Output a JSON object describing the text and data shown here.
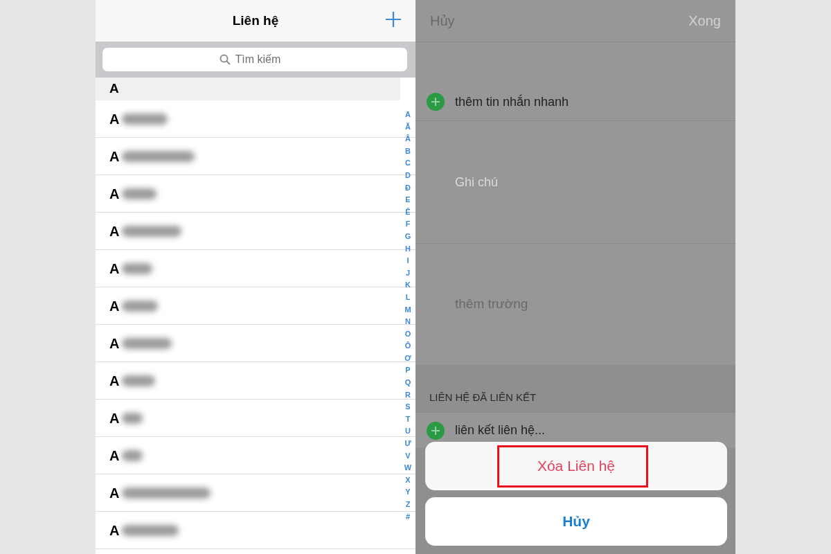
{
  "contacts": {
    "title": "Liên hệ",
    "search": {
      "placeholder": "Tìm kiếm"
    },
    "section_header": "A",
    "rows": [
      {
        "initial": "A"
      },
      {
        "initial": "A"
      },
      {
        "initial": "A"
      },
      {
        "initial": "A"
      },
      {
        "initial": "A"
      },
      {
        "initial": "A"
      },
      {
        "initial": "A"
      },
      {
        "initial": "A"
      },
      {
        "initial": "A"
      },
      {
        "initial": "A"
      },
      {
        "initial": "A"
      },
      {
        "initial": "A"
      }
    ],
    "index": [
      "A",
      "Ă",
      "Â",
      "B",
      "C",
      "D",
      "Đ",
      "E",
      "Ê",
      "F",
      "G",
      "H",
      "I",
      "J",
      "K",
      "L",
      "M",
      "N",
      "O",
      "Ô",
      "Ơ",
      "P",
      "Q",
      "R",
      "S",
      "T",
      "U",
      "Ư",
      "V",
      "W",
      "X",
      "Y",
      "Z",
      "#"
    ]
  },
  "editor": {
    "cancel": "Hủy",
    "done": "Xong",
    "quick_message": "thêm tin nhắn nhanh",
    "notes": {
      "placeholder": "Ghi chú"
    },
    "add_field": "thêm trường",
    "linked_header": "LIÊN HỆ ĐÃ LIÊN KẾT",
    "link_contact": "liên kết liên hệ..."
  },
  "action_sheet": {
    "actions": [
      {
        "label": "Xóa Liên hệ",
        "kind": "destructive",
        "highlighted": true
      }
    ],
    "cancel": "Hủy"
  }
}
